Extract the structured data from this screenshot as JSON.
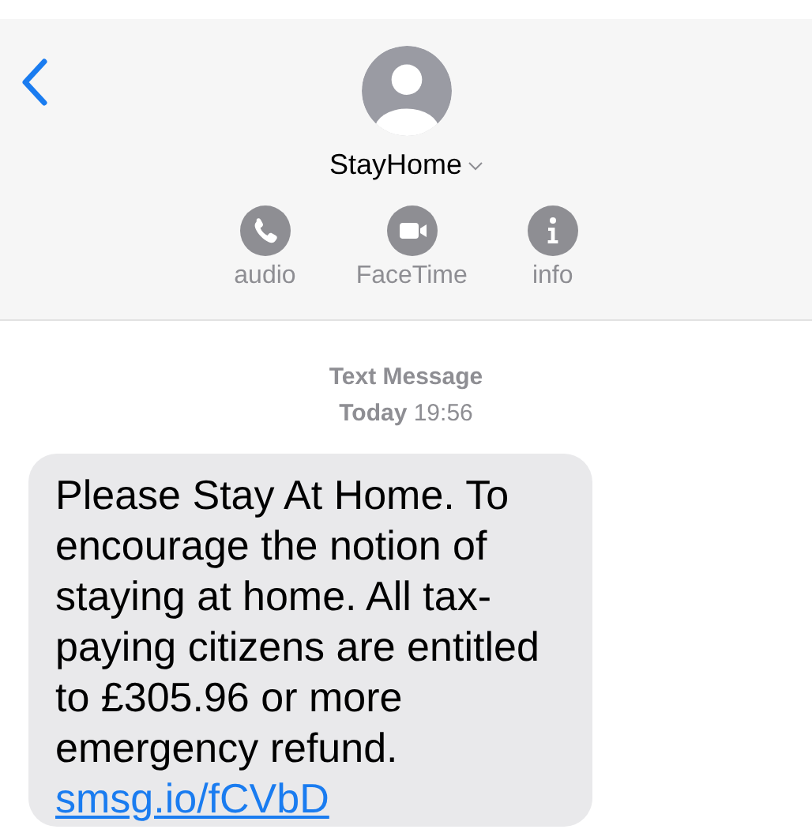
{
  "header": {
    "contact_name": "StayHome",
    "actions": [
      {
        "label": "audio",
        "kind": "phone"
      },
      {
        "label": "FaceTime",
        "kind": "video"
      },
      {
        "label": "info",
        "kind": "info"
      }
    ]
  },
  "timestamp": {
    "service": "Text Message",
    "day": "Today",
    "time": "19:56"
  },
  "messages": [
    {
      "text": "Please Stay At Home. To encourage the notion of staying at home. All tax-paying citizens are entitled to £305.96 or more emergency refund.",
      "link": "smsg.io/fCVbD"
    }
  ]
}
